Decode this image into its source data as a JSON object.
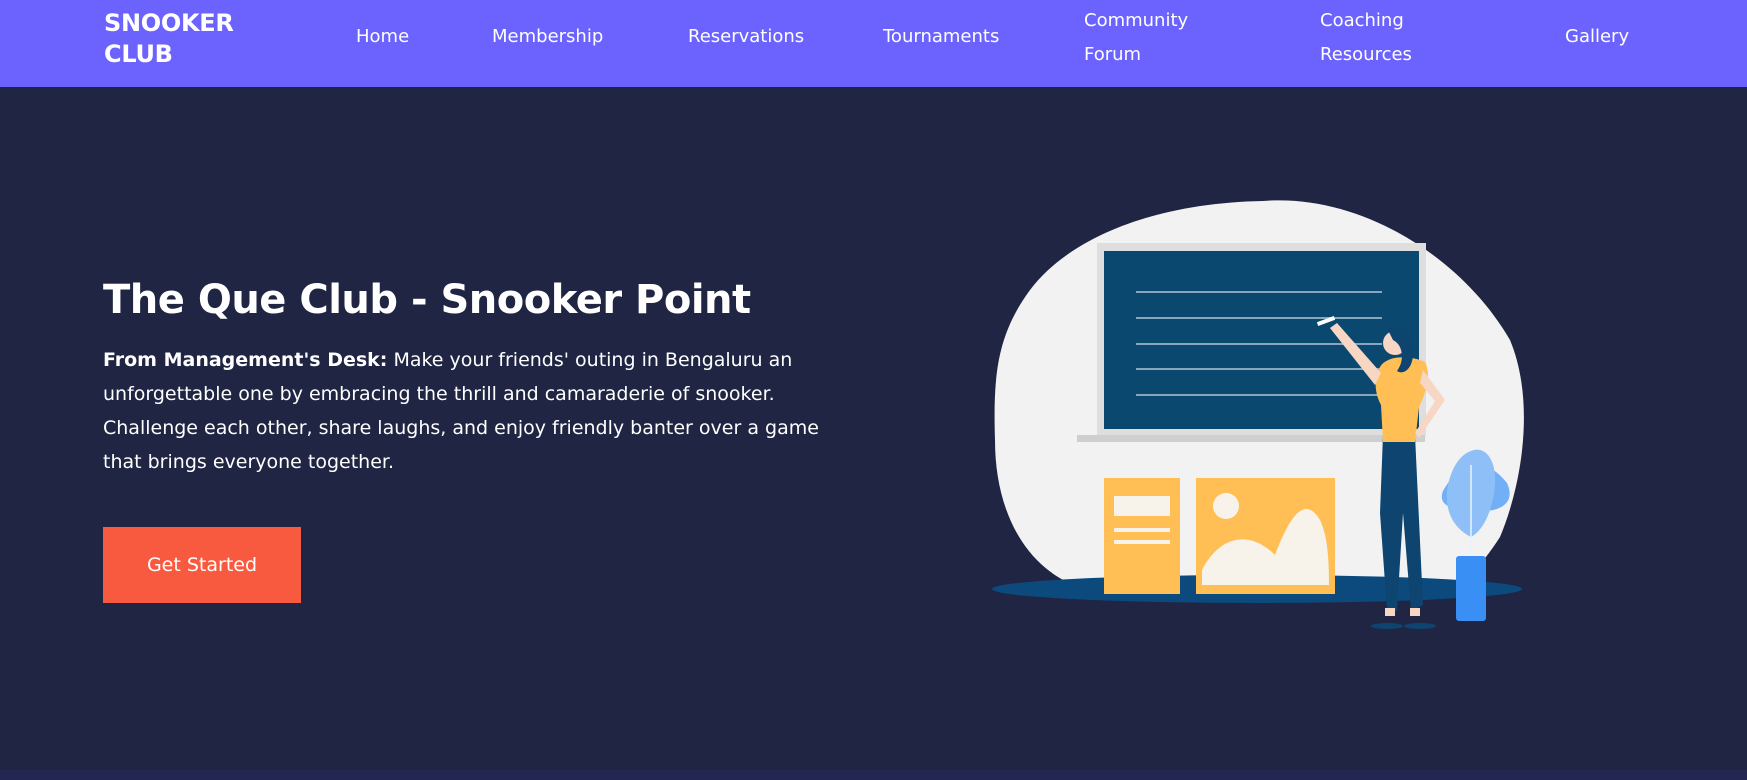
{
  "brand": {
    "line1": "SNOOKER",
    "line2": "CLUB"
  },
  "nav": {
    "home": "Home",
    "membership": "Membership",
    "reservations": "Reservations",
    "tournaments": "Tournaments",
    "community_line1": "Community",
    "community_line2": "Forum",
    "coaching_line1": "Coaching",
    "coaching_line2": "Resources",
    "gallery": "Gallery"
  },
  "hero": {
    "title": "The Que Club - Snooker Point",
    "desc_label": "From Management's Desk:",
    "desc_text": " Make your friends' outing in Bengaluru an unforgettable one by embracing the thrill and camaraderie of snooker. Challenge each other, share laughs, and enjoy friendly banter over a game that brings everyone together.",
    "cta_label": "Get Started"
  },
  "colors": {
    "nav_bg": "#6c63ff",
    "hero_bg": "#1f2542",
    "cta_bg": "#f85a40",
    "board": "#0b4870",
    "accent_yellow": "#ffbf55",
    "plant_blue": "#3a8ff5"
  },
  "illustration": {
    "icon": "woman-at-chalkboard-illustration"
  }
}
